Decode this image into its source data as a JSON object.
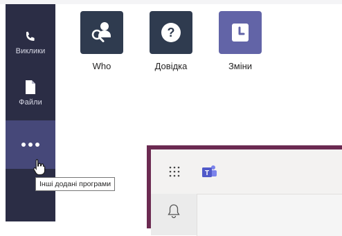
{
  "sidebar": {
    "items": [
      {
        "label": "Виклики",
        "icon": "phone-icon"
      },
      {
        "label": "Файли",
        "icon": "file-icon"
      },
      {
        "label": "",
        "icon": "more-dots-icon"
      }
    ],
    "tooltip": "Інші додані програми"
  },
  "apps": [
    {
      "label": "Who",
      "icon": "who-icon",
      "color": "#2f3b4f"
    },
    {
      "label": "Довідка",
      "icon": "help-icon",
      "color": "#2f3b4f"
    },
    {
      "label": "Зміни",
      "icon": "shifts-icon",
      "color": "#6264a7"
    }
  ],
  "teams_window": {
    "frame_color": "#6b2a51",
    "icons": [
      "app-launcher-icon",
      "teams-logo-icon",
      "bell-icon"
    ]
  },
  "colors": {
    "rail": "#2b2d45",
    "rail_active": "#464879",
    "accent": "#6264a7"
  }
}
